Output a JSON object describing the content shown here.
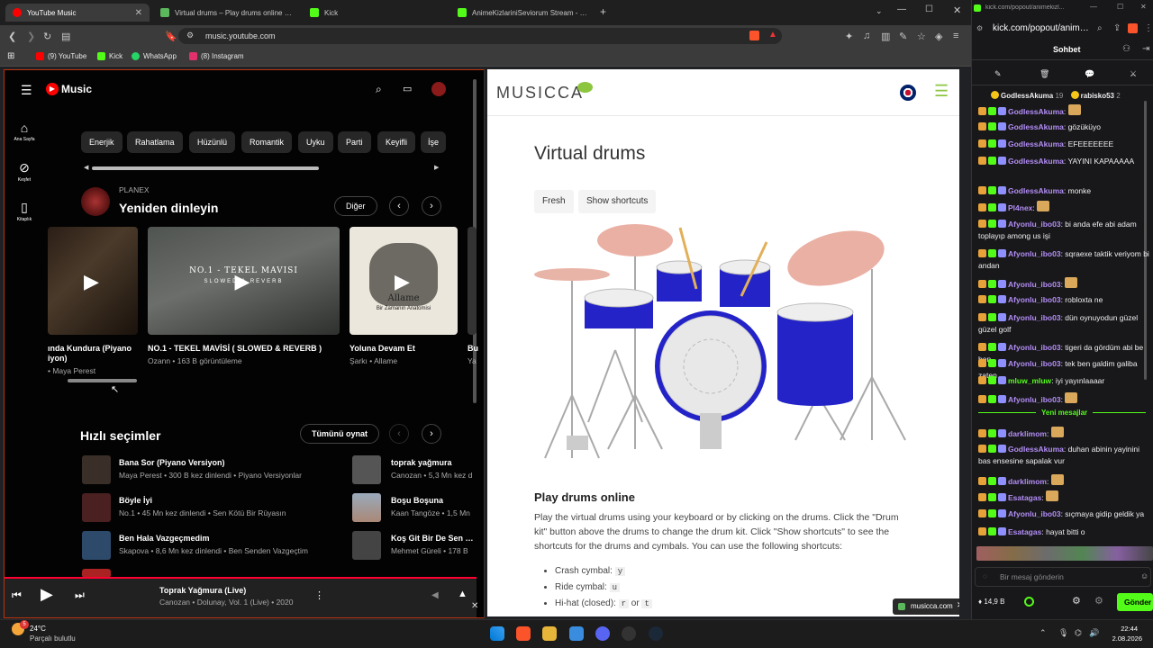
{
  "browser": {
    "tabs": [
      {
        "label": "YouTube Music",
        "color": "#ff0000"
      },
      {
        "label": "Virtual drums – Play drums online | M",
        "color": "#5cb85c"
      },
      {
        "label": "Kick",
        "color": "#53fc18"
      },
      {
        "label": "AnimeKizlariniSeviorum Stream - Wat",
        "color": "#53fc18"
      }
    ],
    "url": "music.youtube.com",
    "bookmarks": [
      {
        "label": "(9) YouTube",
        "color": "#ff0000"
      },
      {
        "label": "Kick",
        "color": "#53fc18"
      },
      {
        "label": "WhatsApp",
        "color": "#25d366"
      },
      {
        "label": "(8) Instagram",
        "color": "#e1306c"
      }
    ]
  },
  "ytmusic": {
    "logo": "Music",
    "sidebar": [
      {
        "label": "Ana Sayfa",
        "icon": "home-icon"
      },
      {
        "label": "Keşfet",
        "icon": "compass-icon"
      },
      {
        "label": "Kitaplık",
        "icon": "library-icon"
      }
    ],
    "chips": [
      "Enerjik",
      "Rahatlama",
      "Hüzünlü",
      "Romantik",
      "Uyku",
      "Parti",
      "Keyifli",
      "İşe"
    ],
    "section1": {
      "owner": "PLANEX",
      "title": "Yeniden dinleyin",
      "more": "Diğer"
    },
    "cards": [
      {
        "title": "ında Kundura (Piyano",
        "title2": "iyon)",
        "sub": "• Maya Perest"
      },
      {
        "title": "NO.1 - TEKEL MAVİSİ ( SLOWED & REVERB )",
        "sub": "Ozann • 163 B görüntüleme",
        "overlay": "NO.1 - TEKEL MAVISI",
        "overlay2": "SLOWED & REVERB"
      },
      {
        "title": "Yoluna Devam Et",
        "sub": "Şarkı • Allame",
        "overlay": "Allame",
        "overlay2": "Bir Zamanın Anatomisi"
      },
      {
        "title": "Bu",
        "sub": "Ya"
      }
    ],
    "section2": {
      "title": "Hızlı seçimler",
      "play_all": "Tümünü oynat"
    },
    "quick_left": [
      {
        "title": "Bana Sor (Piyano Versiyon)",
        "sub": "Maya Perest • 300 B kez dinlendi • Piyano Versiyonlar"
      },
      {
        "title": "Böyle İyi",
        "sub": "No.1 • 45 Mn kez dinlendi • Sen Kötü Bir Rüyasın"
      },
      {
        "title": "Ben Hala Vazgeçmedim",
        "sub": "Skapova • 8,6 Mn kez dinlendi • Ben Senden Vazgeçtim"
      }
    ],
    "quick_right": [
      {
        "title": "toprak yağmura",
        "sub": "Canozan • 5,3 Mn kez d"
      },
      {
        "title": "Boşu Boşuna",
        "sub": "Kaan Tangöze • 1,5 Mn"
      },
      {
        "title": "Koş Git Bir De Sen Bak",
        "sub": "Mehmet Güreli • 178 B"
      }
    ],
    "player": {
      "title": "Toprak Yağmura (Live)",
      "sub": "Canozan • Dolunay, Vol. 1 (Live) • 2020"
    }
  },
  "musicca": {
    "logo": "MUSICCA",
    "title": "Virtual drums",
    "btn_fresh": "Fresh",
    "btn_shortcuts": "Show shortcuts",
    "h2": "Play drums online",
    "para": "Play the virtual drums using your keyboard or by clicking on the drums. Click the \"Drum kit\" button above the drums to change the drum kit. Click \"Show shortcuts\" to see the shortcuts for the drums and cymbals. You can use the following shortcuts:",
    "shortcuts": [
      {
        "name": "Crash cymbal:",
        "k1": "y",
        "or": "",
        "k2": ""
      },
      {
        "name": "Ride cymbal:",
        "k1": "u",
        "or": "",
        "k2": ""
      },
      {
        "name": "Hi-hat (closed):",
        "k1": "r",
        "or": "or",
        "k2": "t"
      }
    ],
    "popup": "musicca.com"
  },
  "chat": {
    "url": "kick.com/popout/animekizl...",
    "url2": "kick.com/popout/anime...",
    "title": "Sohbet",
    "pinned": {
      "user": "GodlessAkuma",
      "n": "19",
      "user2": "rabisko53",
      "n2": "2"
    },
    "messages": [
      {
        "user": "GodlessAkuma",
        "color": "#b38df5",
        "text": ": ",
        "emote": true
      },
      {
        "user": "GodlessAkuma",
        "color": "#b38df5",
        "text": ": gözüküyo"
      },
      {
        "user": "GodlessAkuma",
        "color": "#b38df5",
        "text": ": EFEEEEEEE"
      },
      {
        "user": "GodlessAkuma",
        "color": "#b38df5",
        "text": ": YAYINI KAPAAAAA"
      },
      {
        "user": "GodlessAkuma",
        "color": "#b38df5",
        "text": ": monke"
      },
      {
        "user": "Pl4nex",
        "color": "#b38df5",
        "text": ": ",
        "emote": true
      },
      {
        "user": "Afyonlu_ibo03",
        "color": "#b38df5",
        "text": ": bi anda efe abi adam toplayıp among us işi"
      },
      {
        "user": "Afyonlu_ibo03",
        "color": "#b38df5",
        "text": ": sqraexe taktik veriyom bi andan"
      },
      {
        "user": "Afyonlu_ibo03",
        "color": "#b38df5",
        "text": ": ",
        "emote": true
      },
      {
        "user": "Afyonlu_ibo03",
        "color": "#b38df5",
        "text": ": robloxta ne"
      },
      {
        "user": "Afyonlu_ibo03",
        "color": "#b38df5",
        "text": ": dün oynuyodun güzel güzel golf"
      },
      {
        "user": "Afyonlu_ibo03",
        "color": "#b38df5",
        "text": ": tigeri da gördüm abi be ben"
      },
      {
        "user": "Afyonlu_ibo03",
        "color": "#b38df5",
        "text": ": tek ben galdim galiba zaten"
      },
      {
        "user": "mluw_mluw",
        "color": "#53fc18",
        "text": ": iyi yayınlaaaar"
      },
      {
        "user": "Afyonlu_ibo03",
        "color": "#b38df5",
        "text": ": ",
        "emote": true
      }
    ],
    "new_messages": "Yeni mesajlar",
    "messages2": [
      {
        "user": "darklimom",
        "color": "#b38df5",
        "text": ": ",
        "emote": true
      },
      {
        "user": "GodlessAkuma",
        "color": "#b38df5",
        "text": ": duhan abinin yayinini bas ensesine sapalak vur"
      },
      {
        "user": "darklimom",
        "color": "#b38df5",
        "text": ": ",
        "emote": true
      },
      {
        "user": "Esatagas",
        "color": "#b38df5",
        "text": ": ",
        "emote": true
      },
      {
        "user": "Afyonlu_ibo03",
        "color": "#b38df5",
        "text": ": sıçmaya gidip geldik ya"
      },
      {
        "user": "Esatagas",
        "color": "#b38df5",
        "text": ": hayat bitti o"
      }
    ],
    "input_placeholder": "Bir mesaj gönderin",
    "viewers": "14,9 B",
    "send": "Gönder"
  },
  "taskbar": {
    "weather_temp": "24°C",
    "weather_sub": "Parçalı bulutlu",
    "time": "22:44",
    "date": "2.08.2026",
    "badge": "5"
  }
}
